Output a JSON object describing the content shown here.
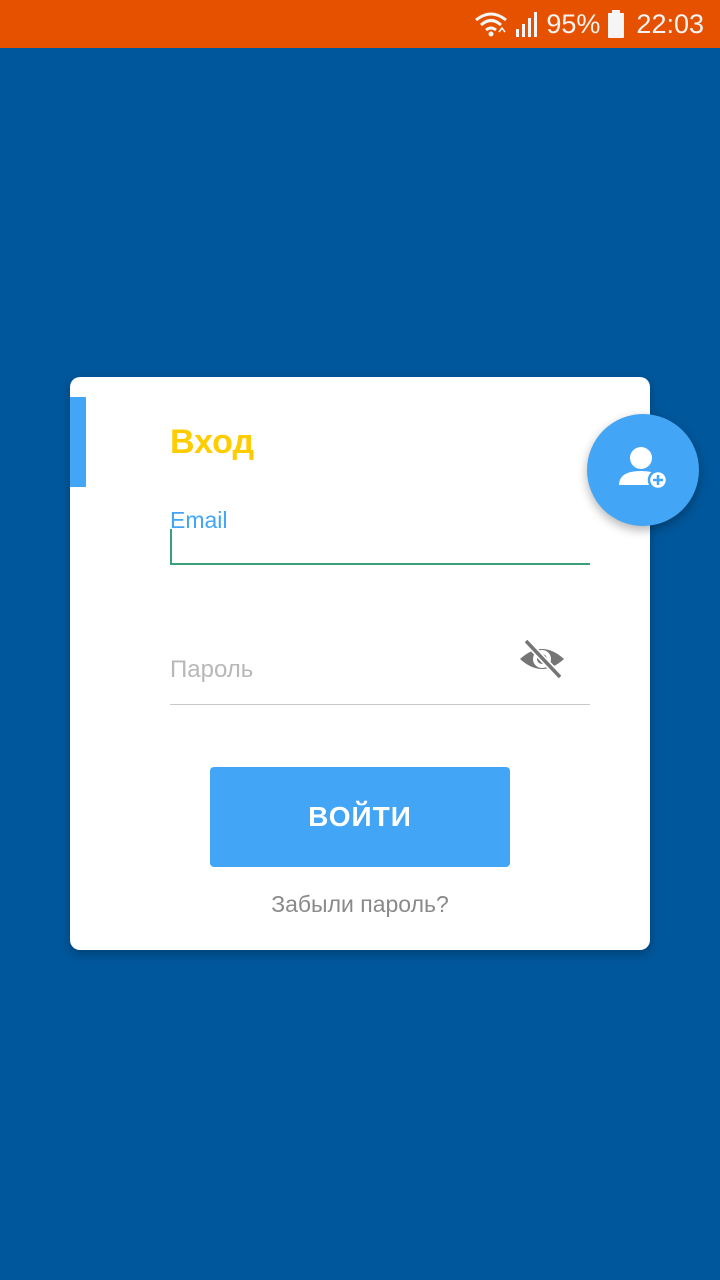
{
  "status_bar": {
    "battery_percent": "95%",
    "time": "22:03",
    "icons": [
      "wifi-icon",
      "signal-icon",
      "battery-icon"
    ],
    "background_color": "#e65100"
  },
  "login": {
    "title": "Вход",
    "email_label": "Email",
    "email_value": "",
    "password_placeholder": "Пароль",
    "password_visibility_icon": "eye-off-icon",
    "submit_label": "ВОЙТИ",
    "forgot_label": "Забыли пароль?"
  },
  "fab": {
    "icon": "add-user-icon"
  },
  "colors": {
    "background": "#01579b",
    "accent": "#42a5f5",
    "title": "#ffcc00",
    "focus_underline": "#3aa07a"
  }
}
